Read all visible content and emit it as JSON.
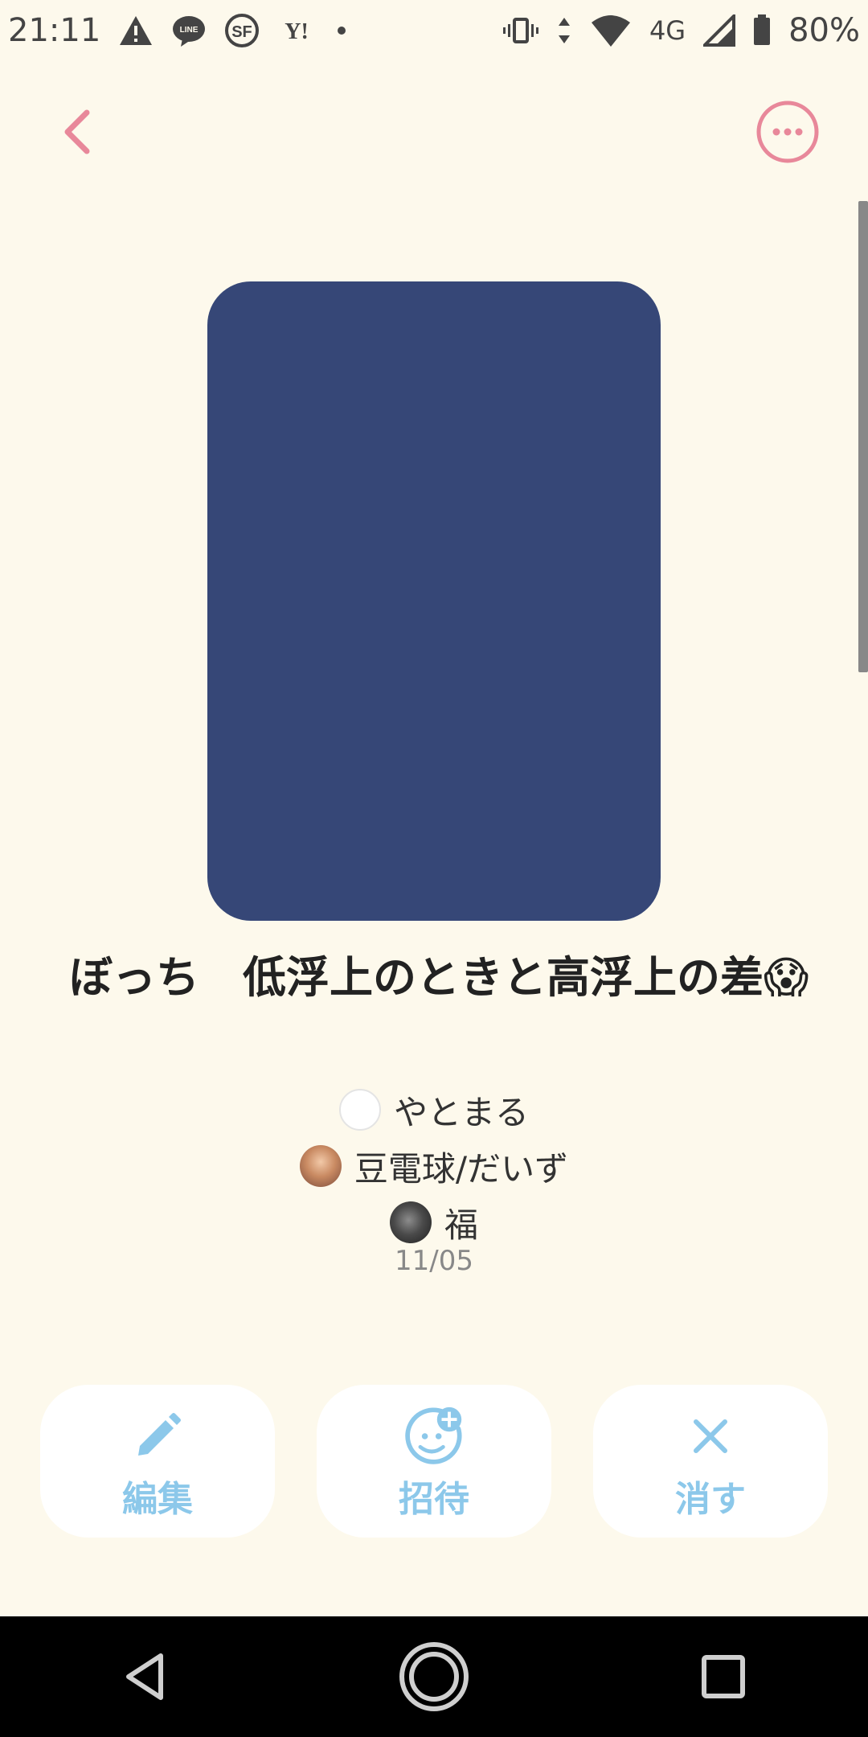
{
  "status_bar": {
    "time": "21:11",
    "network": "4G",
    "battery": "80%",
    "notification_icons": [
      "warning-icon",
      "line-icon",
      "sf-icon",
      "yahoo-icon",
      "dot-icon"
    ],
    "text_color": "#444444"
  },
  "header": {
    "back_icon": "chevron-left-icon",
    "more_icon": "more-horizontal-icon",
    "accent_color": "#e8889a"
  },
  "card": {
    "cover_color": "#364777",
    "title": "ぼっち　低浮上のときと高浮上の差😱",
    "members": [
      {
        "name": "やとまる"
      },
      {
        "name": "豆電球/だいず"
      },
      {
        "name": "福"
      }
    ],
    "date": "11/05"
  },
  "actions": {
    "color": "#8cc8ea",
    "edit": {
      "label": "編集",
      "icon": "pencil-icon"
    },
    "invite": {
      "label": "招待",
      "icon": "smiley-plus-icon"
    },
    "delete": {
      "label": "消す",
      "icon": "x-icon"
    }
  },
  "nav": {
    "back_icon": "nav-back-icon",
    "home_icon": "nav-home-icon",
    "recents_icon": "nav-recents-icon"
  }
}
